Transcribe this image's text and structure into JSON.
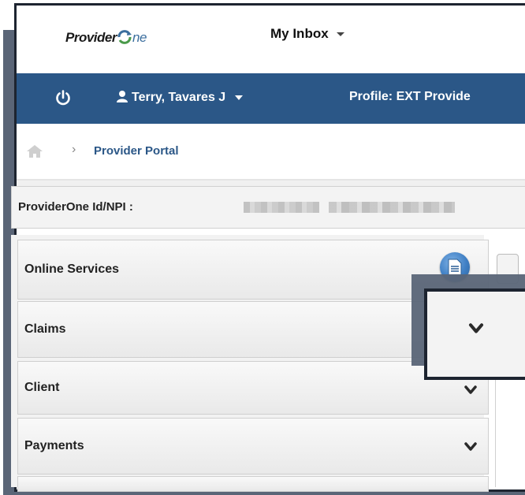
{
  "header": {
    "logo_text": "Provider",
    "logo_suffix": "ne",
    "inbox_label": "My Inbox"
  },
  "userbar": {
    "user_name": "Terry, Tavares J",
    "profile_label": "Profile: EXT Provide"
  },
  "breadcrumb": {
    "current": "Provider Portal"
  },
  "npi": {
    "label": "ProviderOne Id/NPI :"
  },
  "menu": {
    "items": [
      {
        "label": "Online Services"
      },
      {
        "label": "Claims"
      },
      {
        "label": "Client"
      },
      {
        "label": "Payments"
      }
    ]
  },
  "colors": {
    "accent_bar": "#2b5787",
    "frame": "#1d2430",
    "shadow": "#5a6577"
  }
}
